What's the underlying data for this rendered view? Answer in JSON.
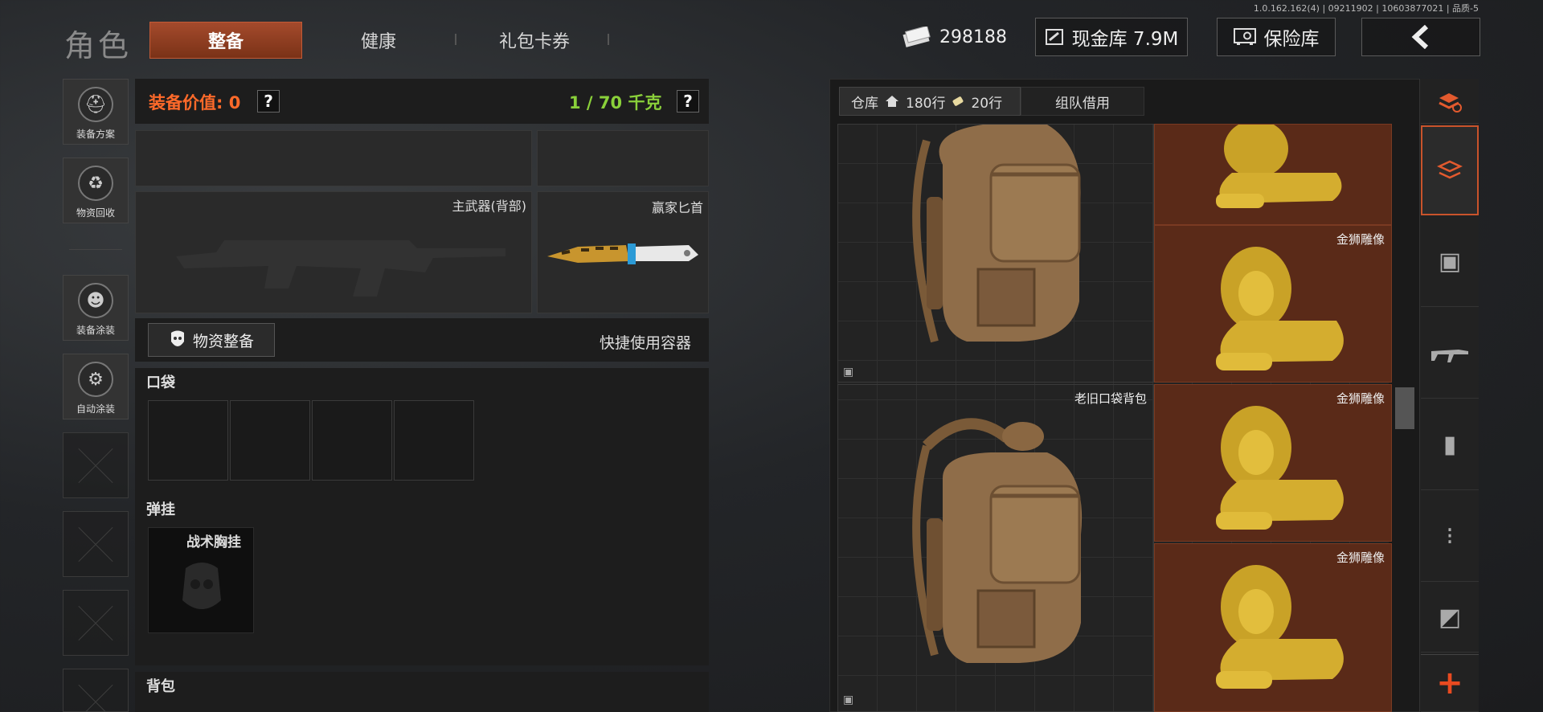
{
  "header": {
    "version": "1.0.162.162(4) | 09211902 | 10603877021 | 品质-5",
    "title": "角色",
    "tabs": [
      "整备",
      "健康",
      "礼包卡券"
    ],
    "money": "298188",
    "cash_vault": "现金库 7.9M",
    "safe_box": "保险库"
  },
  "sidebar": {
    "items": [
      "装备方案",
      "物资回收",
      "装备涂装",
      "自动涂装"
    ]
  },
  "equipment": {
    "value_label": "装备价值: 0",
    "weight_label": "1 / 70 千克",
    "help": "?",
    "primary_weapon": "主武器(背部)",
    "melee": "赢家匕首",
    "supply_button": "物资整备",
    "quick_container": "快捷使用容器",
    "pocket": "口袋",
    "rig": "弹挂",
    "rig_item": "战术胸挂",
    "backpack": "背包"
  },
  "warehouse": {
    "tab_main": "仓库",
    "rows_home": "180行",
    "rows_ticket": "20行",
    "tab_team": "组队借用",
    "items": [
      {
        "name": ""
      },
      {
        "name": ""
      },
      {
        "name": "金狮雕像"
      },
      {
        "name": "老旧口袋背包"
      },
      {
        "name": "金狮雕像"
      },
      {
        "name": "金狮雕像"
      }
    ]
  },
  "colors": {
    "accent": "#c9532b",
    "value_red": "#ff6a2a",
    "weight_green": "#8ad03a"
  }
}
